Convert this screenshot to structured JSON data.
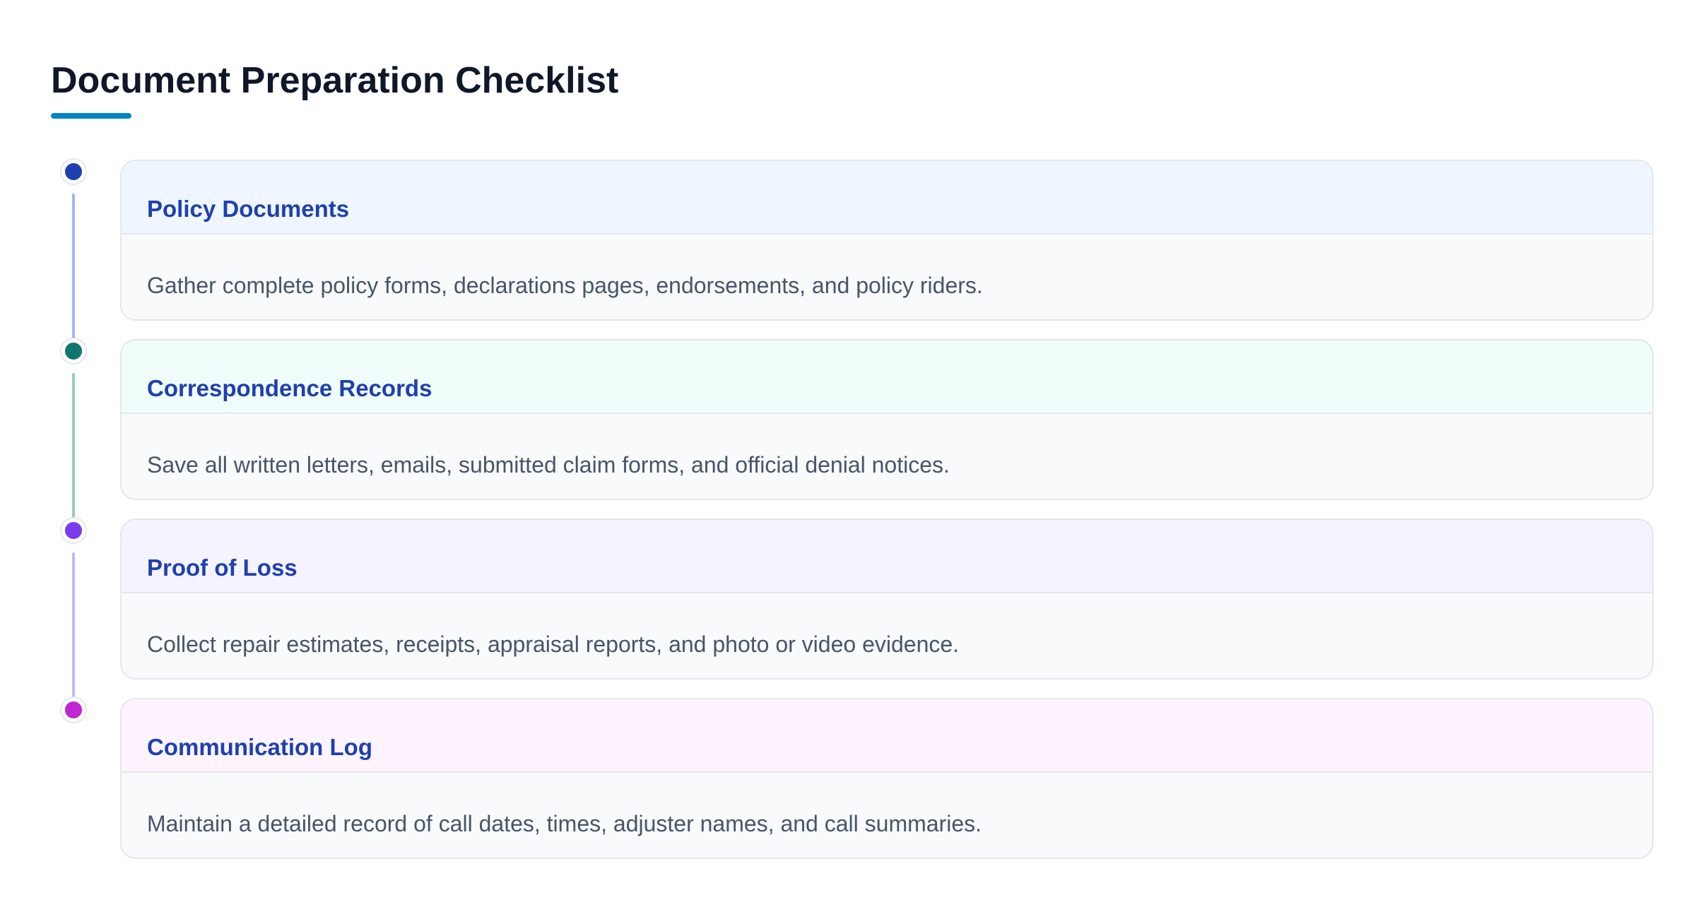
{
  "page": {
    "title": "Document Preparation Checklist",
    "accent_color": "#0284c7"
  },
  "checklist": [
    {
      "title": "Policy Documents",
      "description": "Gather complete policy forms, declarations pages, endorsements, and policy riders.",
      "dot_color": "#1e40af",
      "line_color": "#a5b4fc",
      "header_bg": "#eff6ff"
    },
    {
      "title": "Correspondence Records",
      "description": "Save all written letters, emails, submitted claim forms, and official denial notices.",
      "dot_color": "#0f766e",
      "line_color": "#99c9c2",
      "header_bg": "#f0fdfa"
    },
    {
      "title": "Proof of Loss",
      "description": "Collect repair estimates, receipts, appraisal reports, and photo or video evidence.",
      "dot_color": "#7c3aed",
      "line_color": "#c4b5fd",
      "header_bg": "#f5f3ff"
    },
    {
      "title": "Communication Log",
      "description": "Maintain a detailed record of call dates, times, adjuster names, and call summaries.",
      "dot_color": "#c026d3",
      "line_color": "#f0abfc",
      "header_bg": "#fdf4ff"
    }
  ]
}
